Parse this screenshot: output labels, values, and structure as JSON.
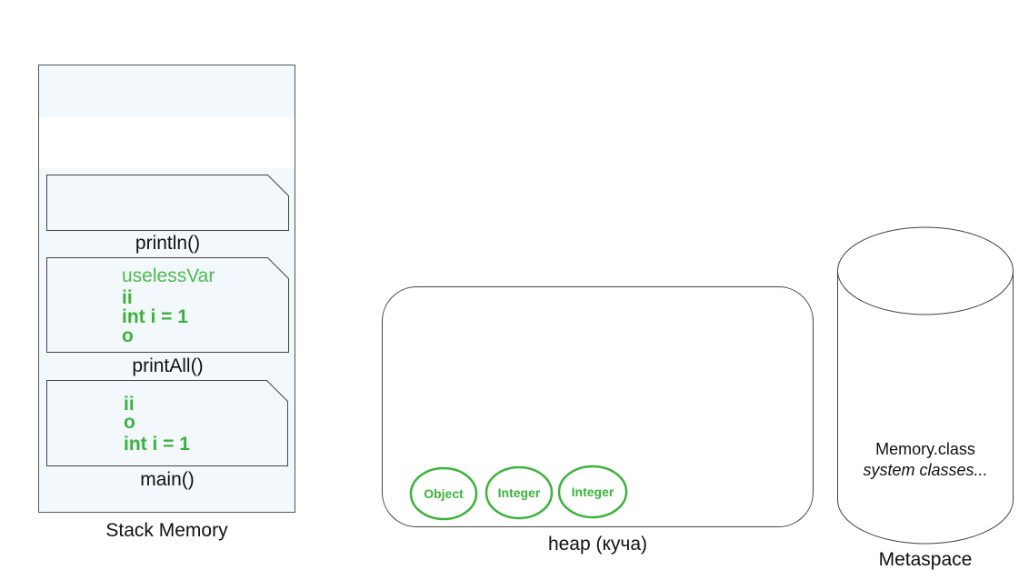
{
  "stack": {
    "label": "Stack Memory",
    "frames": [
      {
        "name": "println()",
        "vars": []
      },
      {
        "name": "printAll()",
        "vars": [
          {
            "text": "uselessVar",
            "style": "light"
          },
          {
            "text": "ii",
            "style": "bold"
          },
          {
            "text": "int i = 1",
            "style": "bold"
          },
          {
            "text": "o",
            "style": "bold"
          }
        ]
      },
      {
        "name": "main()",
        "vars": [
          {
            "text": "ii",
            "style": "bold"
          },
          {
            "text": "o",
            "style": "bold"
          },
          {
            "text": "int i = 1",
            "style": "bold"
          }
        ]
      }
    ]
  },
  "heap": {
    "label": "heap (куча)",
    "objects": [
      "Object",
      "Integer",
      "Integer"
    ]
  },
  "metaspace": {
    "label": "Metaspace",
    "line1": "Memory.class",
    "line2": "system classes..."
  },
  "colors": {
    "green": "#3bb33b",
    "frame_fill": "#f3f8fc",
    "outline": "#555555"
  }
}
